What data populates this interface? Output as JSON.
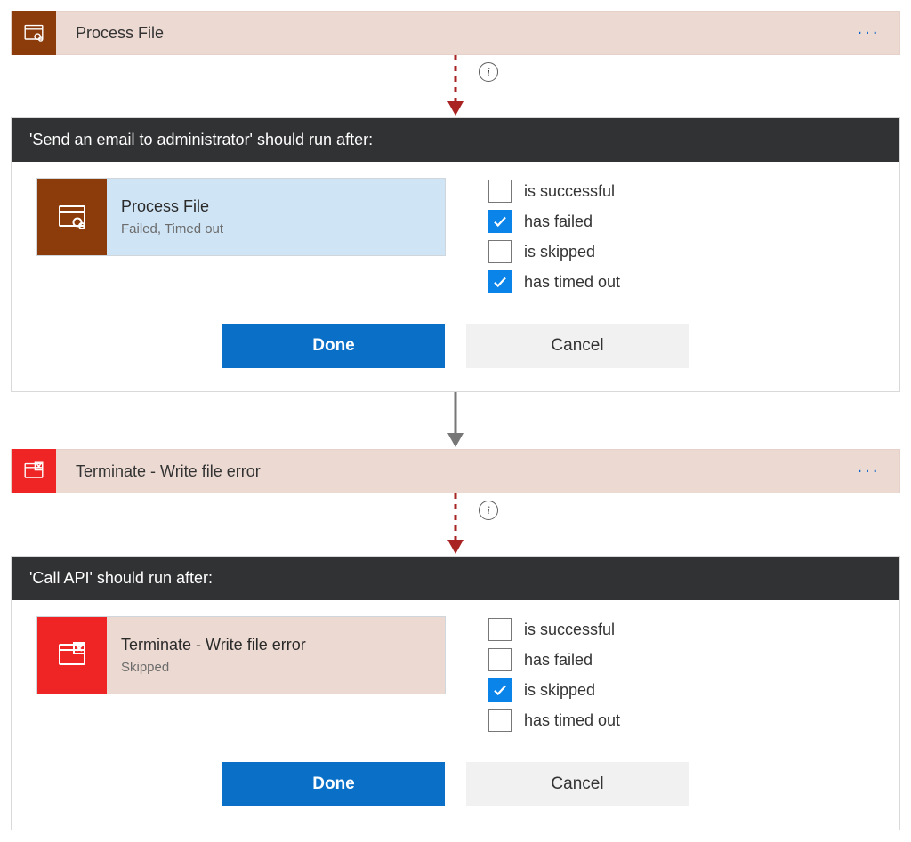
{
  "step1": {
    "title": "Process File",
    "more": "···"
  },
  "panel1": {
    "header": "'Send an email to administrator' should run after:",
    "dep": {
      "title": "Process File",
      "sub": "Failed, Timed out"
    },
    "checks": {
      "successful": {
        "label": "is successful",
        "checked": false
      },
      "failed": {
        "label": "has failed",
        "checked": true
      },
      "skipped": {
        "label": "is skipped",
        "checked": false
      },
      "timedout": {
        "label": "has timed out",
        "checked": true
      }
    },
    "done": "Done",
    "cancel": "Cancel"
  },
  "step2": {
    "title": "Terminate - Write file error",
    "more": "···"
  },
  "panel2": {
    "header": "'Call API' should run after:",
    "dep": {
      "title": "Terminate - Write file error",
      "sub": "Skipped"
    },
    "checks": {
      "successful": {
        "label": "is successful",
        "checked": false
      },
      "failed": {
        "label": "has failed",
        "checked": false
      },
      "skipped": {
        "label": "is skipped",
        "checked": true
      },
      "timedout": {
        "label": "has timed out",
        "checked": false
      }
    },
    "done": "Done",
    "cancel": "Cancel"
  },
  "info_glyph": "i"
}
